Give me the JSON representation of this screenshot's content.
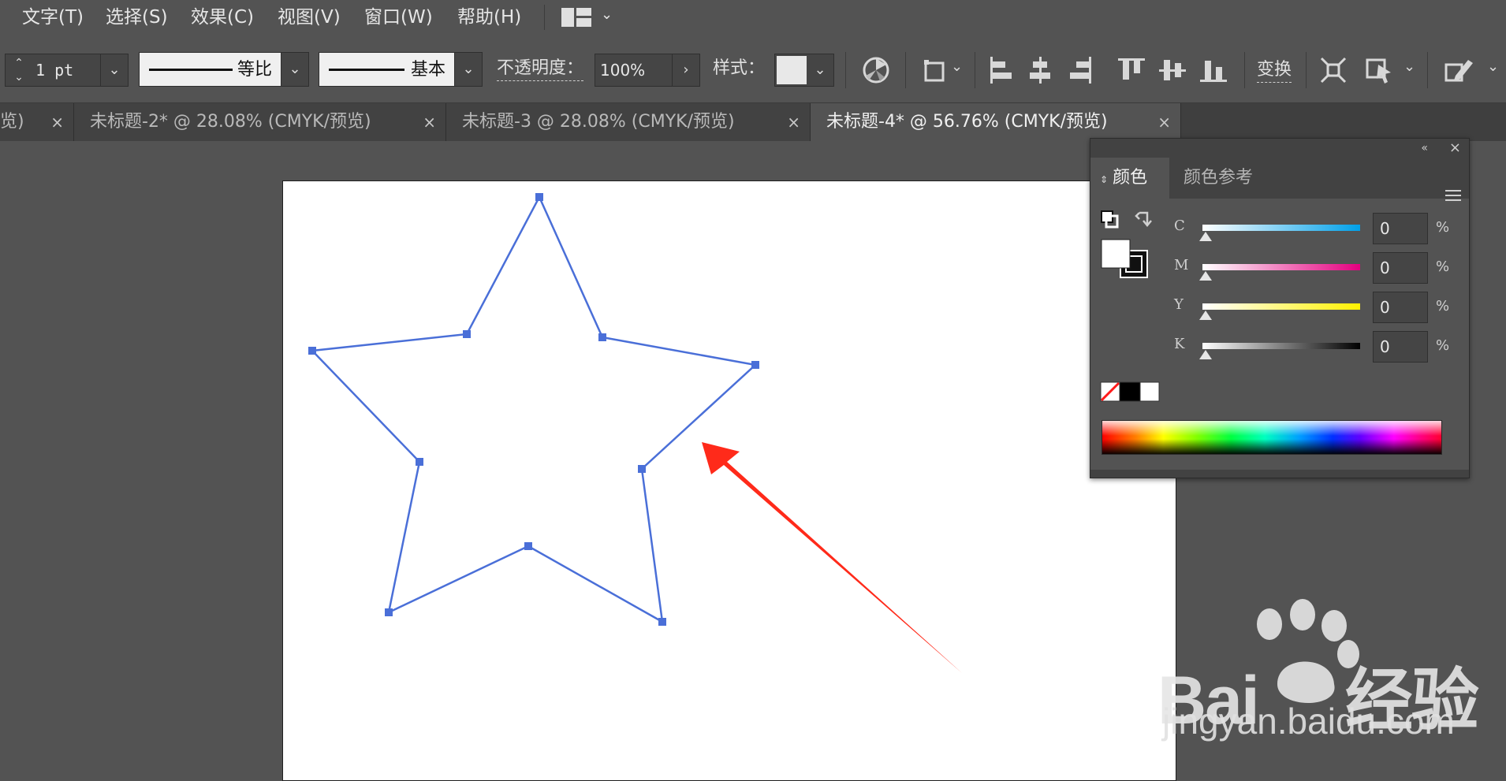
{
  "menubar": {
    "items": [
      "文字(T)",
      "选择(S)",
      "效果(C)",
      "视图(V)",
      "窗口(W)",
      "帮助(H)"
    ]
  },
  "controlbar": {
    "stroke_weight": "1 pt",
    "profile_uniform": "等比",
    "brush_basic": "基本",
    "opacity_label": "不透明度：",
    "opacity_value": "100%",
    "style_label": "样式：",
    "transform_label": "变换"
  },
  "tabs": [
    {
      "label": "览)",
      "active": false
    },
    {
      "label": "未标题-2* @ 28.08% (CMYK/预览)",
      "active": false
    },
    {
      "label": "未标题-3 @ 28.08% (CMYK/预览)",
      "active": false
    },
    {
      "label": "未标题-4* @ 56.76% (CMYK/预览)",
      "active": true
    }
  ],
  "tab_close_glyph": "×",
  "color_panel": {
    "tab_color": "颜色",
    "tab_color_guide": "颜色参考",
    "channels": [
      {
        "letter": "C",
        "value": "0",
        "unit": "%",
        "color": "#00a0e9"
      },
      {
        "letter": "M",
        "value": "0",
        "unit": "%",
        "color": "#e4007f"
      },
      {
        "letter": "Y",
        "value": "0",
        "unit": "%",
        "color": "#fff100"
      },
      {
        "letter": "K",
        "value": "0",
        "unit": "%",
        "color": "#000000"
      }
    ]
  },
  "colors": {
    "selection": "#4a6fd8",
    "arrow": "#ff2a1a"
  },
  "watermark": {
    "brand_latin": "Bai",
    "brand_cn": "经验",
    "url": "jingyan.baidu.com"
  }
}
